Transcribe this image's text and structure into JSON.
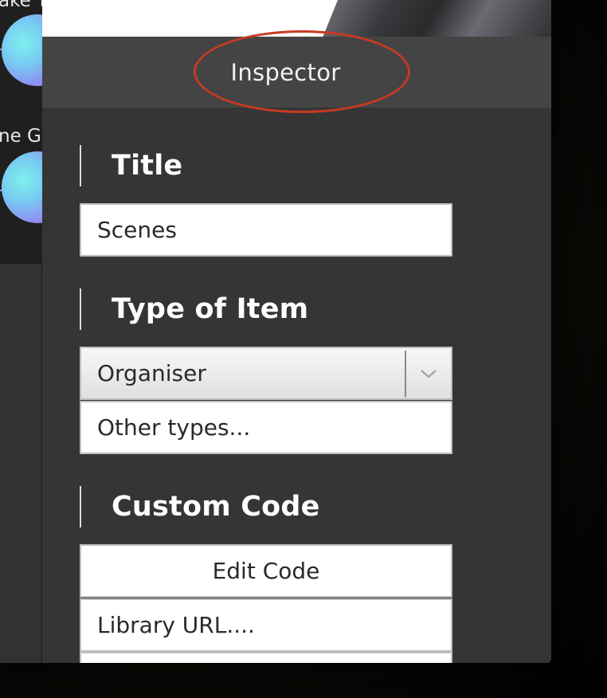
{
  "left_panel": {
    "nodes": [
      {
        "label": "ake T"
      },
      {
        "label": "ne Ga"
      }
    ]
  },
  "inspector": {
    "title": "Inspector",
    "sections": {
      "title": {
        "heading": "Title",
        "value": "Scenes"
      },
      "type": {
        "heading": "Type of Item",
        "selected": "Organiser",
        "other_types": "Other types..."
      },
      "custom_code": {
        "heading": "Custom Code",
        "edit_button": "Edit Code",
        "library_url": "Library URL...."
      }
    }
  },
  "colors": {
    "annotation": "#c83a22",
    "panel": "#353535",
    "header": "#444444"
  }
}
